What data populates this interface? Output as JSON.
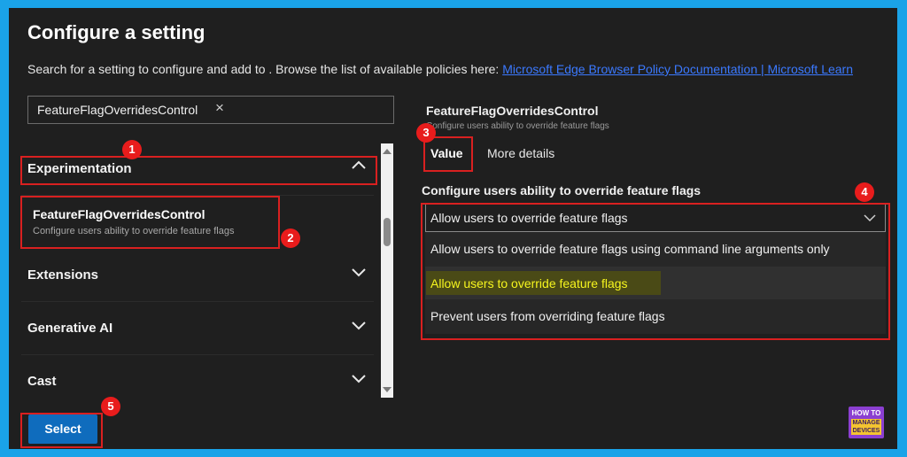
{
  "header": {
    "title": "Configure a setting",
    "description": "Search for a setting to configure and add to . Browse the list of available policies here:",
    "link_text": "Microsoft Edge Browser Policy Documentation | Microsoft Learn"
  },
  "search": {
    "value": "FeatureFlagOverridesControl",
    "clear_icon": "×"
  },
  "categories": [
    {
      "label": "Experimentation",
      "expanded": true
    },
    {
      "label": "Extensions"
    },
    {
      "label": "Generative AI"
    },
    {
      "label": "Cast"
    }
  ],
  "selected_setting": {
    "name": "FeatureFlagOverridesControl",
    "description": "Configure users ability to override feature flags"
  },
  "details": {
    "name": "FeatureFlagOverridesControl",
    "description": "Configure users ability to override feature flags",
    "tabs": [
      "Value",
      "More details"
    ],
    "field_label": "Configure users ability to override feature flags",
    "dropdown_value": "Allow users to override feature flags",
    "options": [
      "Allow users to override feature flags using command line arguments only",
      "Allow users to override feature flags",
      "Prevent users from overriding feature flags"
    ]
  },
  "footer": {
    "select_label": "Select"
  },
  "annotations": {
    "badges": [
      "1",
      "2",
      "3",
      "4",
      "5"
    ],
    "annotation_color": "#d92020",
    "highlight_color": "#f6f51e"
  },
  "logo": {
    "top": "HOW TO",
    "bottom": "MANAGE DEVICES"
  }
}
